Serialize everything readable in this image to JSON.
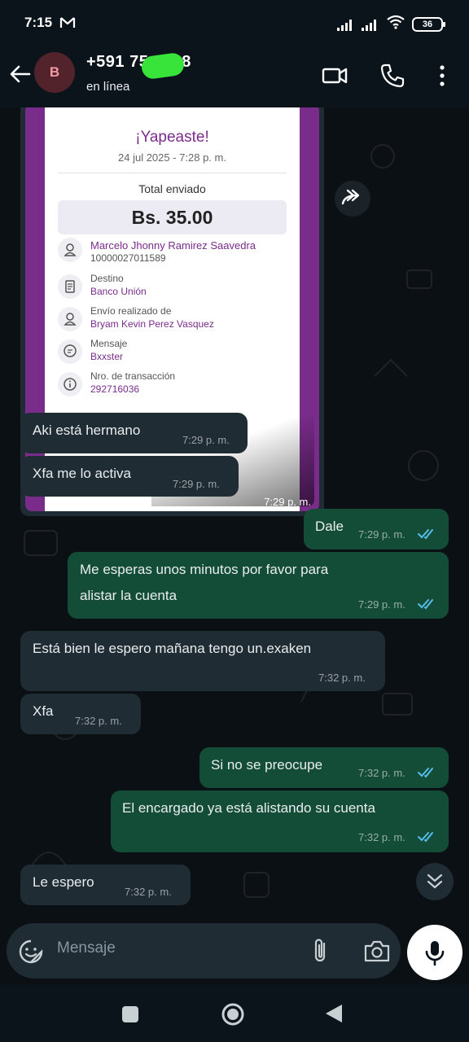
{
  "status_bar": {
    "time": "7:15",
    "notification_icon": "gmail-icon",
    "battery": "36"
  },
  "header": {
    "avatar_letter": "B",
    "contact_name": "+591 75      0688",
    "status": "en línea",
    "icons": [
      "back-arrow-icon",
      "video-call-icon",
      "phone-icon",
      "more-vert-icon"
    ]
  },
  "receipt": {
    "title": "¡Yapeaste!",
    "date": "24 jul 2025 - 7:28 p. m.",
    "total_label": "Total enviado",
    "amount": "Bs. 35.00",
    "recipient_name": "Marcelo Jhonny Ramirez Saavedra",
    "recipient_number": "10000027011589",
    "destino_label": "Destino",
    "destino_value": "Banco Unión",
    "sender_label": "Envío realizado de",
    "sender_value": "Bryam Kevin Perez Vasquez",
    "message_label": "Mensaje",
    "message_value": "Bxxster",
    "transaction_label": "Nro. de transacción",
    "transaction_value": "292716036",
    "time": "7:29 p. m."
  },
  "messages": [
    {
      "id": "m1",
      "direction": "in",
      "text": "Aki está hermano",
      "time": "7:29 p. m."
    },
    {
      "id": "m2",
      "direction": "in",
      "text": "Xfa me lo activa",
      "time": "7:29 p. m."
    },
    {
      "id": "m3",
      "direction": "out",
      "text": "Dale",
      "time": "7:29 p. m.",
      "read": true
    },
    {
      "id": "m4",
      "direction": "out",
      "text_line1": "Me esperas unos minutos por favor para",
      "text_line2": "alistar la cuenta",
      "time": "7:29 p. m.",
      "read": true
    },
    {
      "id": "m5",
      "direction": "in",
      "text": "Está bien le espero mañana tengo un.exaken",
      "time": "7:32 p. m."
    },
    {
      "id": "m6",
      "direction": "in",
      "text": "Xfa",
      "time": "7:32 p. m."
    },
    {
      "id": "m7",
      "direction": "out",
      "text": "Si no se preocupe",
      "time": "7:32 p. m.",
      "read": true
    },
    {
      "id": "m8",
      "direction": "out",
      "text": "El encargado ya está alistando su cuenta",
      "time": "7:32 p. m.",
      "read": true
    },
    {
      "id": "m9",
      "direction": "in",
      "text": "Le espero",
      "time": "7:32 p. m."
    }
  ],
  "input": {
    "placeholder": "Mensaje"
  },
  "colors": {
    "incoming_bubble": "#1f2c33",
    "outgoing_bubble": "#144d37",
    "read_ticks": "#53bdeb",
    "receipt_accent": "#7a2c8b"
  }
}
